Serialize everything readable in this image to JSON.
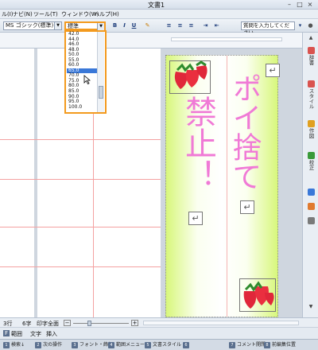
{
  "window": {
    "title": "文書1"
  },
  "menu": [
    "ル(I)",
    "ナビ(N)",
    "ツール(T)",
    "ウィンドウ(W)",
    "ヘルプ(H)"
  ],
  "toolbar": {
    "font_name": "MS ゴシック(標準)",
    "font_size": "標準",
    "bold": "B",
    "italic": "I",
    "underline": "U",
    "help_placeholder": "質問を入力してください"
  },
  "font_size_dropdown": {
    "options": [
      "42.0",
      "44.0",
      "46.0",
      "48.0",
      "50.0",
      "55.0",
      "60.0",
      "65.0",
      "70.0",
      "75.0",
      "80.0",
      "85.0",
      "90.0",
      "95.0",
      "100.0"
    ],
    "highlighted": "65.0"
  },
  "document": {
    "poster_text_main": "ポイ捨て",
    "poster_text_sub": "禁止！",
    "return_mark": "↵"
  },
  "sidebar": [
    {
      "label": "辞書",
      "icon": "dictionary-icon",
      "color": "#d9534f"
    },
    {
      "label": "スタイル",
      "icon": "style-icon",
      "color": "#d9534f"
    },
    {
      "label": "作図",
      "icon": "drawing-icon",
      "color": "#e0a020"
    },
    {
      "label": "校正",
      "icon": "proofread-icon",
      "color": "#3a9a3a"
    }
  ],
  "status": {
    "line": "3行",
    "col": "6字",
    "print_mode": "印字全面",
    "zoom_minus": "−",
    "zoom_plus": "+"
  },
  "bottom_tabs": [
    "F",
    "範囲",
    "文字",
    "挿入"
  ],
  "fkeys": [
    {
      "num": "1",
      "label": "検索↓"
    },
    {
      "num": "2",
      "label": "次の操作"
    },
    {
      "num": "3",
      "label": "フォント・飾り"
    },
    {
      "num": "4",
      "label": "範囲メニュー"
    },
    {
      "num": "5",
      "label": "文書スタイル"
    },
    {
      "num": "6",
      "label": ""
    },
    {
      "num": "7",
      "label": "コメント開閉"
    },
    {
      "num": "8",
      "label": "前編集位置"
    }
  ],
  "colors": {
    "highlight_border": "#f39a1e",
    "poster_text": "#f07ad6",
    "poster_gradient": "#d8f77c",
    "selection": "#3a78d8"
  }
}
